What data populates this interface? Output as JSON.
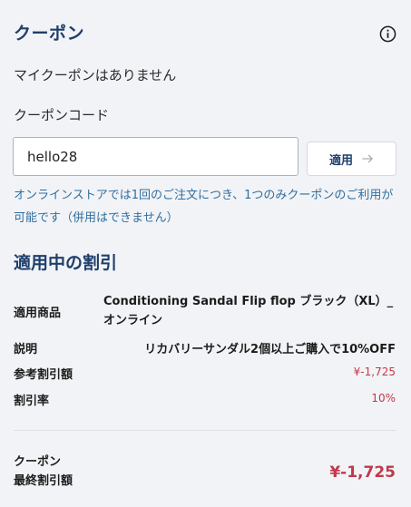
{
  "coupon": {
    "title": "クーポン",
    "no_coupons": "マイクーポンはありません",
    "code_label": "クーポンコード",
    "code_value": "hello28",
    "apply_label": "適用",
    "note": "オンラインストアでは1回のご注文につき、1つのみクーポンのご利用が可能です（併用はできません）"
  },
  "applied": {
    "section_title": "適用中の割引",
    "product_label": "適用商品",
    "product_value": "Conditioning Sandal Flip flop ブラック（XL）_オンライン",
    "description_label": "説明",
    "description_value": "リカバリーサンダル2個以上ご購入で10%OFF",
    "reference_discount_label": "参考割引額",
    "reference_discount_value": "¥-1,725",
    "discount_rate_label": "割引率",
    "discount_rate_value": "10%"
  },
  "final": {
    "label_line1": "クーポン",
    "label_line2": "最終割引額",
    "value": "¥-1,725"
  },
  "colors": {
    "accent": "#1f3f6c",
    "note": "#2f6fa1",
    "discount": "#c0394b",
    "background": "#f2f3f6"
  },
  "icons": {
    "info": "info-icon",
    "arrow": "arrow-right-icon"
  }
}
